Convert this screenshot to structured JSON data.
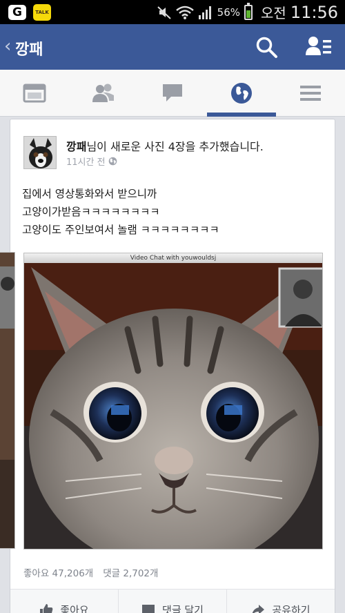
{
  "status_bar": {
    "carrier_icon": "G",
    "talk_icon": "TALK",
    "battery_percent": "56%",
    "battery_level": 0.56,
    "ampm": "오전",
    "time": "11:56"
  },
  "header": {
    "back_icon": "chevron-left-icon",
    "title": "깡패",
    "search_icon": "search-icon",
    "friends_icon": "friend-requests-icon",
    "color": "#3b5998"
  },
  "tabs": [
    {
      "icon": "news-feed-icon"
    },
    {
      "icon": "friends-icon"
    },
    {
      "icon": "messages-icon"
    },
    {
      "icon": "globe-notifications-icon",
      "active": true
    },
    {
      "icon": "menu-icon"
    }
  ],
  "post": {
    "author": "깡패",
    "action": "님이 새로운 사진 4장을 추가했습니다.",
    "time": "11시간 전",
    "privacy_icon": "globe-icon",
    "text_lines": [
      "집에서 영상통화와서 받으니까",
      "고양이가받음ㅋㅋㅋㅋㅋㅋㅋㅋ",
      "고양이도 주인보여서 놀램 ㅋㅋㅋㅋㅋㅋㅋㅋ"
    ],
    "photo_caption": "Video Chat with youwouldsj",
    "likes": "좋아요 47,206개",
    "comments": "댓글 2,702개"
  },
  "actions": [
    {
      "label": "좋아요",
      "icon": "thumbs-up-icon"
    },
    {
      "label": "댓글 달기",
      "icon": "comment-icon"
    },
    {
      "label": "공유하기",
      "icon": "share-icon"
    }
  ]
}
